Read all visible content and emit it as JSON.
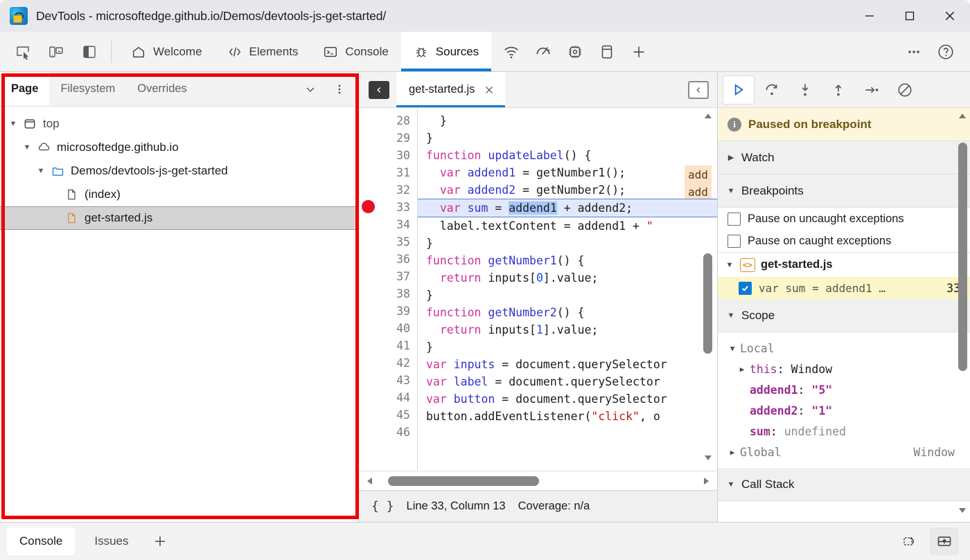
{
  "window": {
    "title": "DevTools - microsoftedge.github.io/Demos/devtools-js-get-started/",
    "logo_name": "edge-devtools-logo",
    "controls": {
      "minimize": "minimize-icon",
      "maximize": "maximize-icon",
      "close": "close-icon"
    }
  },
  "toolbar": {
    "left_icons": [
      {
        "name": "inspect-element-icon"
      },
      {
        "name": "device-emulation-icon"
      },
      {
        "name": "dock-side-icon"
      }
    ],
    "tabs": [
      {
        "label": "Welcome",
        "icon": "home-icon",
        "active": false
      },
      {
        "label": "Elements",
        "icon": "code-brackets-icon",
        "active": false
      },
      {
        "label": "Console",
        "icon": "console-prompt-icon",
        "active": false
      },
      {
        "label": "Sources",
        "icon": "bug-icon",
        "active": true
      }
    ],
    "icon_tabs": [
      {
        "name": "network-icon"
      },
      {
        "name": "performance-icon"
      },
      {
        "name": "memory-icon"
      },
      {
        "name": "application-icon"
      },
      {
        "name": "more-tabs-plus-icon"
      }
    ],
    "right_icons": [
      {
        "name": "more-options-icon"
      },
      {
        "name": "help-icon"
      }
    ],
    "active_accent": "#0f7ad6"
  },
  "navigator": {
    "tabs": [
      {
        "label": "Page",
        "active": true
      },
      {
        "label": "Filesystem",
        "active": false
      },
      {
        "label": "Overrides",
        "active": false
      }
    ],
    "tools": [
      {
        "name": "more-tabs-chevron-icon"
      },
      {
        "name": "navigator-more-options-icon"
      }
    ],
    "tree": [
      {
        "label": "top",
        "icon": "frame-icon",
        "depth": 0,
        "caret": "down",
        "selected": false,
        "dim": true
      },
      {
        "label": "microsoftedge.github.io",
        "icon": "cloud-icon",
        "depth": 1,
        "caret": "down",
        "selected": false,
        "dim": false
      },
      {
        "label": "Demos/devtools-js-get-started",
        "icon": "folder-icon",
        "depth": 2,
        "caret": "down",
        "selected": false,
        "dim": false
      },
      {
        "label": "(index)",
        "icon": "document-icon",
        "depth": 3,
        "caret": "none",
        "selected": false,
        "dim": false
      },
      {
        "label": "get-started.js",
        "icon": "js-file-icon",
        "depth": 3,
        "caret": "none",
        "selected": true,
        "dim": false
      }
    ]
  },
  "editor": {
    "panel_toggle_icon": "show-navigator-icon",
    "undock_icon": "show-debugger-icon",
    "file_tab": {
      "label": "get-started.js",
      "close_icon": "close-tab-icon"
    },
    "first_line_number": 28,
    "lines": [
      {
        "n": 28,
        "tokens": [
          {
            "t": "  }",
            "c": ""
          }
        ]
      },
      {
        "n": 29,
        "tokens": [
          {
            "t": "}",
            "c": ""
          }
        ]
      },
      {
        "n": 30,
        "tokens": [
          {
            "t": "function ",
            "c": "kw"
          },
          {
            "t": "updateLabel",
            "c": "fn"
          },
          {
            "t": "() {",
            "c": ""
          }
        ]
      },
      {
        "n": 31,
        "tokens": [
          {
            "t": "  ",
            "c": ""
          },
          {
            "t": "var ",
            "c": "kw"
          },
          {
            "t": "addend1",
            "c": "var-blue"
          },
          {
            "t": " = getNumber1();",
            "c": ""
          }
        ],
        "inline": "add"
      },
      {
        "n": 32,
        "tokens": [
          {
            "t": "  ",
            "c": ""
          },
          {
            "t": "var ",
            "c": "kw"
          },
          {
            "t": "addend2",
            "c": "var-blue"
          },
          {
            "t": " = getNumber2();",
            "c": ""
          }
        ],
        "inline": "add"
      },
      {
        "n": 33,
        "exec": true,
        "tokens": [
          {
            "t": "  ",
            "c": ""
          },
          {
            "t": "var ",
            "c": "kw"
          },
          {
            "t": "sum",
            "c": "var-blue"
          },
          {
            "t": " = ",
            "c": ""
          },
          {
            "t": "addend1",
            "c": "sel"
          },
          {
            "t": " + addend2;",
            "c": ""
          }
        ]
      },
      {
        "n": 34,
        "tokens": [
          {
            "t": "  label.textContent = addend1 + ",
            "c": ""
          },
          {
            "t": "\" ",
            "c": "str"
          }
        ]
      },
      {
        "n": 35,
        "tokens": [
          {
            "t": "}",
            "c": ""
          }
        ]
      },
      {
        "n": 36,
        "tokens": [
          {
            "t": "function ",
            "c": "kw"
          },
          {
            "t": "getNumber1",
            "c": "fn"
          },
          {
            "t": "() {",
            "c": ""
          }
        ]
      },
      {
        "n": 37,
        "tokens": [
          {
            "t": "  ",
            "c": ""
          },
          {
            "t": "return ",
            "c": "kw"
          },
          {
            "t": "inputs[",
            "c": ""
          },
          {
            "t": "0",
            "c": "num"
          },
          {
            "t": "].value;",
            "c": ""
          }
        ]
      },
      {
        "n": 38,
        "tokens": [
          {
            "t": "}",
            "c": ""
          }
        ]
      },
      {
        "n": 39,
        "tokens": [
          {
            "t": "function ",
            "c": "kw"
          },
          {
            "t": "getNumber2",
            "c": "fn"
          },
          {
            "t": "() {",
            "c": ""
          }
        ]
      },
      {
        "n": 40,
        "tokens": [
          {
            "t": "  ",
            "c": ""
          },
          {
            "t": "return ",
            "c": "kw"
          },
          {
            "t": "inputs[",
            "c": ""
          },
          {
            "t": "1",
            "c": "num"
          },
          {
            "t": "].value;",
            "c": ""
          }
        ]
      },
      {
        "n": 41,
        "tokens": [
          {
            "t": "}",
            "c": ""
          }
        ]
      },
      {
        "n": 42,
        "tokens": [
          {
            "t": "var ",
            "c": "kw"
          },
          {
            "t": "inputs",
            "c": "var-blue"
          },
          {
            "t": " = document.querySelector",
            "c": ""
          }
        ]
      },
      {
        "n": 43,
        "tokens": [
          {
            "t": "var ",
            "c": "kw"
          },
          {
            "t": "label",
            "c": "var-blue"
          },
          {
            "t": " = document.querySelector",
            "c": ""
          }
        ]
      },
      {
        "n": 44,
        "tokens": [
          {
            "t": "var ",
            "c": "kw"
          },
          {
            "t": "button",
            "c": "var-blue"
          },
          {
            "t": " = document.querySelector",
            "c": ""
          }
        ]
      },
      {
        "n": 45,
        "tokens": [
          {
            "t": "button.addEventListener(",
            "c": ""
          },
          {
            "t": "\"click\"",
            "c": "str"
          },
          {
            "t": ", o",
            "c": ""
          }
        ]
      },
      {
        "n": 46,
        "tokens": [
          {
            "t": "",
            "c": ""
          }
        ]
      }
    ],
    "breakpoint_line": 33,
    "status": {
      "format_icon": "pretty-print-icon",
      "cursor": "Line 33, Column 13",
      "coverage": "Coverage: n/a"
    }
  },
  "debugger": {
    "controls": [
      {
        "name": "resume-script-execution-button",
        "primary": true
      },
      {
        "name": "step-over-next-function-call-button",
        "primary": false
      },
      {
        "name": "step-into-next-function-call-button",
        "primary": false
      },
      {
        "name": "step-out-of-current-function-button",
        "primary": false
      },
      {
        "name": "step-button",
        "primary": false
      },
      {
        "name": "deactivate-breakpoints-button",
        "primary": false
      }
    ],
    "paused_banner": "Paused on breakpoint",
    "watch": {
      "label": "Watch",
      "expanded": false
    },
    "breakpoints": {
      "label": "Breakpoints",
      "expanded": true,
      "options": [
        {
          "label": "Pause on uncaught exceptions",
          "checked": false
        },
        {
          "label": "Pause on caught exceptions",
          "checked": false
        }
      ],
      "file": "get-started.js",
      "items": [
        {
          "snippet": "var sum = addend1 …",
          "line": "33",
          "checked": true
        }
      ]
    },
    "scope": {
      "label": "Scope",
      "expanded": true,
      "groups": [
        {
          "name": "Local",
          "expanded": true,
          "entries": [
            {
              "name": "this",
              "value": "Window",
              "caret": true,
              "style": "this"
            },
            {
              "name": "addend1",
              "value": "\"5\"",
              "caret": false,
              "style": "prop"
            },
            {
              "name": "addend2",
              "value": "\"1\"",
              "caret": false,
              "style": "prop"
            },
            {
              "name": "sum",
              "value": "undefined",
              "caret": false,
              "style": "undef"
            }
          ]
        },
        {
          "name": "Global",
          "expanded": false,
          "right": "Window",
          "entries": []
        }
      ]
    },
    "call_stack": {
      "label": "Call Stack",
      "expanded": true
    }
  },
  "drawer": {
    "tabs": [
      {
        "label": "Console",
        "active": true
      },
      {
        "label": "Issues",
        "active": false
      }
    ],
    "add_icon": "add-drawer-tab-icon",
    "right_icons": [
      {
        "name": "restore-drawer-icon"
      },
      {
        "name": "dock-drawer-icon"
      }
    ]
  },
  "annotation": {
    "color": "#ee0000",
    "target": "navigator-panel"
  }
}
